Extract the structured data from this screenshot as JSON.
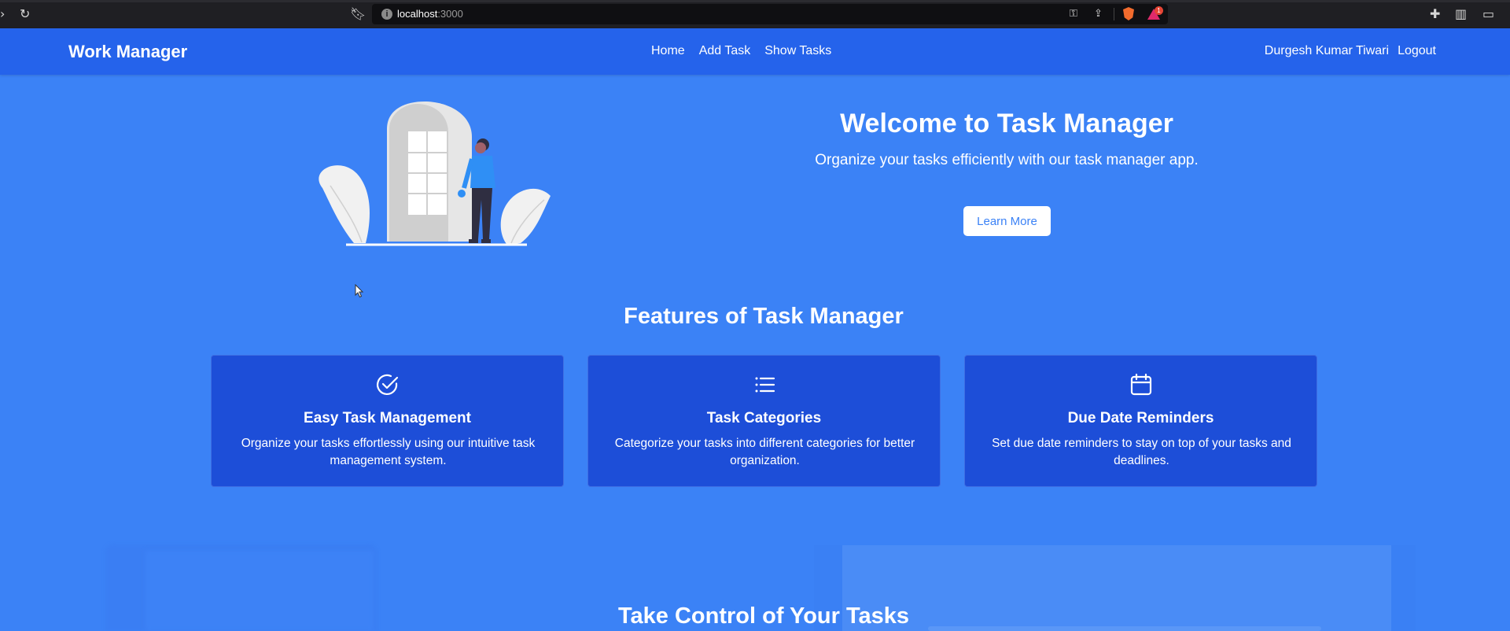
{
  "browser": {
    "url_host": "localhost",
    "url_port": ":3000"
  },
  "navbar": {
    "brand": "Work Manager",
    "links": [
      "Home",
      "Add Task",
      "Show Tasks"
    ],
    "user_name": "Durgesh Kumar Tiwari",
    "logout": "Logout"
  },
  "hero": {
    "title": "Welcome to Task Manager",
    "subtitle": "Organize your tasks efficiently with our task manager app.",
    "button": "Learn More"
  },
  "features": {
    "title": "Features of Task Manager",
    "cards": [
      {
        "icon": "check-circle-icon",
        "title": "Easy Task Management",
        "description": "Organize your tasks effortlessly using our intuitive task management system."
      },
      {
        "icon": "list-icon",
        "title": "Task Categories",
        "description": "Categorize your tasks into different categories for better organization."
      },
      {
        "icon": "calendar-icon",
        "title": "Due Date Reminders",
        "description": "Set due date reminders to stay on top of your tasks and deadlines."
      }
    ]
  },
  "control": {
    "title": "Take Control of Your Tasks"
  },
  "colors": {
    "page_bg": "#3b82f6",
    "navbar_bg": "#2563eb",
    "card_bg": "#1d4ed8",
    "text": "#ffffff"
  }
}
